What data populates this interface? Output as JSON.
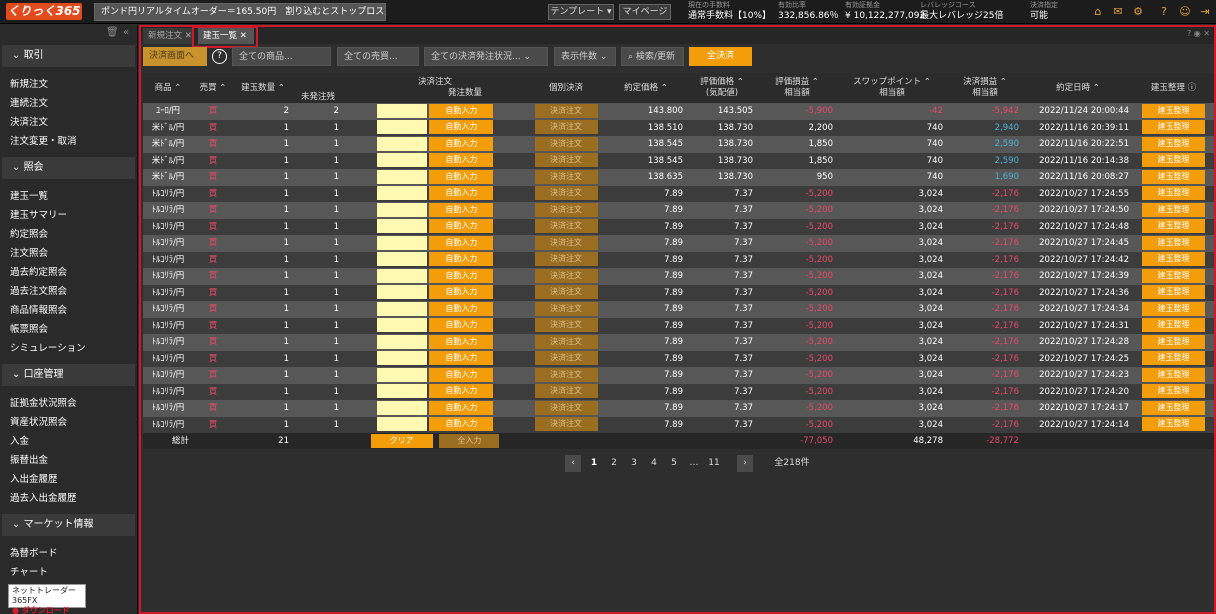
{
  "app": {
    "logo": "くりっく365",
    "ticker": "ポンド円リアルタイムオーダー＝165.50円　割り込むとストップロス売り",
    "template_btn": "テンプレート ▾",
    "mypage_btn": "マイページ"
  },
  "stats": [
    {
      "label": "現在の手数料",
      "value": "通常手数料【10%】"
    },
    {
      "label": "有効比率",
      "value": "332,856.86％"
    },
    {
      "label": "有効証拠金",
      "value": "¥ 10,122,277,092"
    },
    {
      "label": "レバレッジコース",
      "value": "最大レバレッジ25倍"
    },
    {
      "label": "決済指定",
      "value": "可能"
    }
  ],
  "top_icons": [
    "home-icon",
    "mail-icon",
    "gear-icon",
    "help-icon",
    "user-icon",
    "logout-icon"
  ],
  "sidebar": {
    "sections": [
      {
        "title": "取引",
        "items": [
          "新規注文",
          "連続注文",
          "決済注文",
          "注文変更・取消"
        ]
      },
      {
        "title": "照会",
        "items": [
          "建玉一覧",
          "建玉サマリー",
          "約定照会",
          "注文照会",
          "過去約定照会",
          "過去注文照会",
          "商品情報照会",
          "帳票照会",
          "シミュレーション"
        ]
      },
      {
        "title": "口座管理",
        "items": [
          "証拠金状況照会",
          "資産状況照会",
          "入金",
          "振替出金",
          "入出金履歴",
          "過去入出金履歴"
        ]
      },
      {
        "title": "マーケット情報",
        "items": [
          "為替ボード",
          "チャート"
        ]
      }
    ],
    "download": {
      "line1": "ネットトレーダー365FX",
      "line2": "ダウンロード"
    }
  },
  "tabs": {
    "tab1": "新規注文",
    "tab2": "建玉一覧"
  },
  "toolbar": {
    "to_settle": "決済画面へ",
    "product_ph": "全ての商品...",
    "side_ph": "全ての売買...",
    "status_ph": "全ての決済発注状況...",
    "count": "表示件数",
    "search": "検索/更新",
    "settle_all": "全決済"
  },
  "table": {
    "headers": {
      "product": "商品",
      "side": "売買",
      "qty": "建玉数量",
      "unfilled": "未発注残",
      "settle_order": "決済注文",
      "order_qty": "発注数量",
      "individual": "個別決済",
      "price": "約定価格",
      "eval_price": "評価価格",
      "eval_price2": "(気配値)",
      "pl": "評価損益",
      "pl2": "相当額",
      "swap": "スワップポイント",
      "swap2": "相当額",
      "settle_pl": "決済損益",
      "settle_pl2": "相当額",
      "datetime": "約定日時",
      "manage": "建玉整理"
    },
    "btn_auto": "自動入力",
    "btn_settle": "決済注文",
    "btn_manage": "建玉整理",
    "rows": [
      {
        "product": "ﾕｰﾛ/円",
        "side": "買",
        "qty": "2",
        "unfilled": "2",
        "price": "143.800",
        "eval": "143.505",
        "pl": "-5,900",
        "swap": "-42",
        "settle_pl": "-5,942",
        "dt": "2022/11/24 20:00:44"
      },
      {
        "product": "米ﾄﾞﾙ/円",
        "side": "買",
        "qty": "1",
        "unfilled": "1",
        "price": "138.510",
        "eval": "138.730",
        "pl": "2,200",
        "swap": "740",
        "settle_pl": "2,940",
        "dt": "2022/11/16 20:39:11"
      },
      {
        "product": "米ﾄﾞﾙ/円",
        "side": "買",
        "qty": "1",
        "unfilled": "1",
        "price": "138.545",
        "eval": "138.730",
        "pl": "1,850",
        "swap": "740",
        "settle_pl": "2,590",
        "dt": "2022/11/16 20:22:51"
      },
      {
        "product": "米ﾄﾞﾙ/円",
        "side": "買",
        "qty": "1",
        "unfilled": "1",
        "price": "138.545",
        "eval": "138.730",
        "pl": "1,850",
        "swap": "740",
        "settle_pl": "2,590",
        "dt": "2022/11/16 20:14:38"
      },
      {
        "product": "米ﾄﾞﾙ/円",
        "side": "買",
        "qty": "1",
        "unfilled": "1",
        "price": "138.635",
        "eval": "138.730",
        "pl": "950",
        "swap": "740",
        "settle_pl": "1,690",
        "dt": "2022/11/16 20:08:27"
      },
      {
        "product": "ﾄﾙｺﾘﾗ/円",
        "side": "買",
        "qty": "1",
        "unfilled": "1",
        "price": "7.89",
        "eval": "7.37",
        "pl": "-5,200",
        "swap": "3,024",
        "settle_pl": "-2,176",
        "dt": "2022/10/27 17:24:55"
      },
      {
        "product": "ﾄﾙｺﾘﾗ/円",
        "side": "買",
        "qty": "1",
        "unfilled": "1",
        "price": "7.89",
        "eval": "7.37",
        "pl": "-5,200",
        "swap": "3,024",
        "settle_pl": "-2,176",
        "dt": "2022/10/27 17:24:50"
      },
      {
        "product": "ﾄﾙｺﾘﾗ/円",
        "side": "買",
        "qty": "1",
        "unfilled": "1",
        "price": "7.89",
        "eval": "7.37",
        "pl": "-5,200",
        "swap": "3,024",
        "settle_pl": "-2,176",
        "dt": "2022/10/27 17:24:48"
      },
      {
        "product": "ﾄﾙｺﾘﾗ/円",
        "side": "買",
        "qty": "1",
        "unfilled": "1",
        "price": "7.89",
        "eval": "7.37",
        "pl": "-5,200",
        "swap": "3,024",
        "settle_pl": "-2,176",
        "dt": "2022/10/27 17:24:45"
      },
      {
        "product": "ﾄﾙｺﾘﾗ/円",
        "side": "買",
        "qty": "1",
        "unfilled": "1",
        "price": "7.89",
        "eval": "7.37",
        "pl": "-5,200",
        "swap": "3,024",
        "settle_pl": "-2,176",
        "dt": "2022/10/27 17:24:42"
      },
      {
        "product": "ﾄﾙｺﾘﾗ/円",
        "side": "買",
        "qty": "1",
        "unfilled": "1",
        "price": "7.89",
        "eval": "7.37",
        "pl": "-5,200",
        "swap": "3,024",
        "settle_pl": "-2,176",
        "dt": "2022/10/27 17:24:39"
      },
      {
        "product": "ﾄﾙｺﾘﾗ/円",
        "side": "買",
        "qty": "1",
        "unfilled": "1",
        "price": "7.89",
        "eval": "7.37",
        "pl": "-5,200",
        "swap": "3,024",
        "settle_pl": "-2,176",
        "dt": "2022/10/27 17:24:36"
      },
      {
        "product": "ﾄﾙｺﾘﾗ/円",
        "side": "買",
        "qty": "1",
        "unfilled": "1",
        "price": "7.89",
        "eval": "7.37",
        "pl": "-5,200",
        "swap": "3,024",
        "settle_pl": "-2,176",
        "dt": "2022/10/27 17:24:34"
      },
      {
        "product": "ﾄﾙｺﾘﾗ/円",
        "side": "買",
        "qty": "1",
        "unfilled": "1",
        "price": "7.89",
        "eval": "7.37",
        "pl": "-5,200",
        "swap": "3,024",
        "settle_pl": "-2,176",
        "dt": "2022/10/27 17:24:31"
      },
      {
        "product": "ﾄﾙｺﾘﾗ/円",
        "side": "買",
        "qty": "1",
        "unfilled": "1",
        "price": "7.89",
        "eval": "7.37",
        "pl": "-5,200",
        "swap": "3,024",
        "settle_pl": "-2,176",
        "dt": "2022/10/27 17:24:28"
      },
      {
        "product": "ﾄﾙｺﾘﾗ/円",
        "side": "買",
        "qty": "1",
        "unfilled": "1",
        "price": "7.89",
        "eval": "7.37",
        "pl": "-5,200",
        "swap": "3,024",
        "settle_pl": "-2,176",
        "dt": "2022/10/27 17:24:25"
      },
      {
        "product": "ﾄﾙｺﾘﾗ/円",
        "side": "買",
        "qty": "1",
        "unfilled": "1",
        "price": "7.89",
        "eval": "7.37",
        "pl": "-5,200",
        "swap": "3,024",
        "settle_pl": "-2,176",
        "dt": "2022/10/27 17:24:23"
      },
      {
        "product": "ﾄﾙｺﾘﾗ/円",
        "side": "買",
        "qty": "1",
        "unfilled": "1",
        "price": "7.89",
        "eval": "7.37",
        "pl": "-5,200",
        "swap": "3,024",
        "settle_pl": "-2,176",
        "dt": "2022/10/27 17:24:20"
      },
      {
        "product": "ﾄﾙｺﾘﾗ/円",
        "side": "買",
        "qty": "1",
        "unfilled": "1",
        "price": "7.89",
        "eval": "7.37",
        "pl": "-5,200",
        "swap": "3,024",
        "settle_pl": "-2,176",
        "dt": "2022/10/27 17:24:17"
      },
      {
        "product": "ﾄﾙｺﾘﾗ/円",
        "side": "買",
        "qty": "1",
        "unfilled": "1",
        "price": "7.89",
        "eval": "7.37",
        "pl": "-5,200",
        "swap": "3,024",
        "settle_pl": "-2,176",
        "dt": "2022/10/27 17:24:14"
      }
    ],
    "footer": {
      "label": "総計",
      "qty": "21",
      "clear": "クリア",
      "fill_all": "全入力",
      "pl": "-77,050",
      "swap": "48,278",
      "settle_pl": "-28,772"
    }
  },
  "pager": {
    "pages": [
      "1",
      "2",
      "3",
      "4",
      "5",
      "…",
      "11"
    ],
    "current": "1",
    "total": "全218件"
  }
}
